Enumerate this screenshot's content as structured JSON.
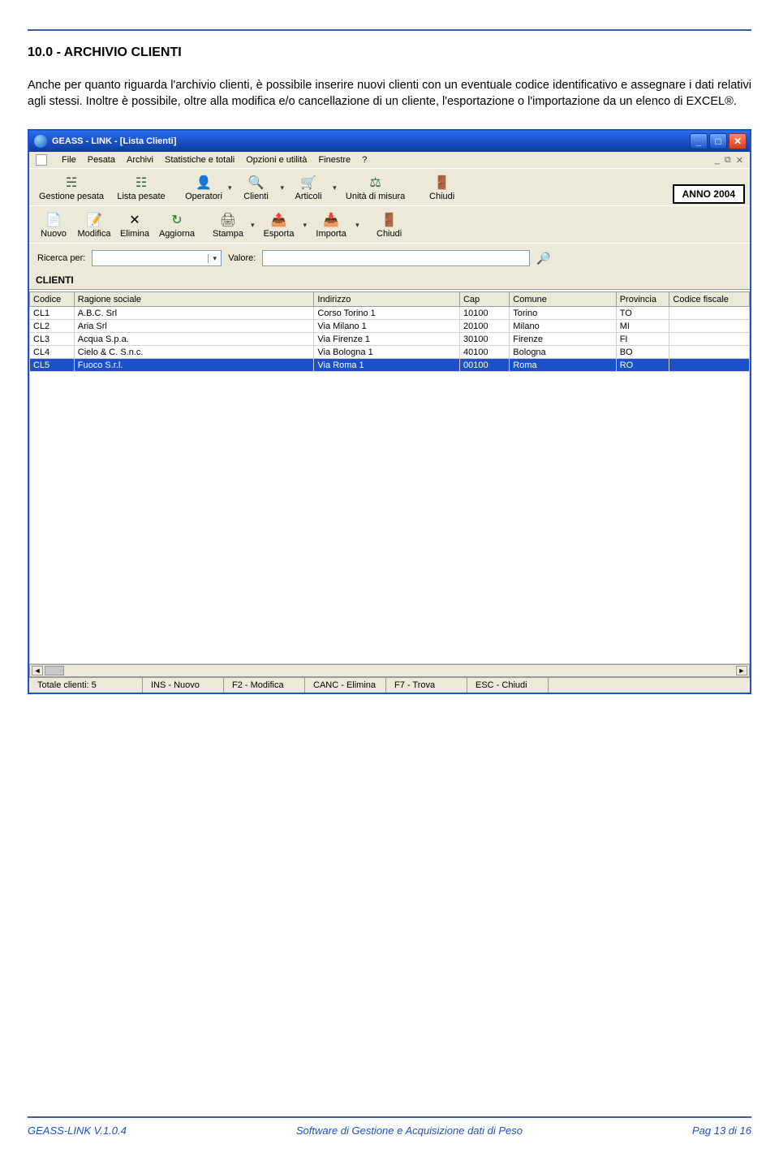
{
  "doc": {
    "section_number": "10.0 -  ARCHIVIO CLIENTI",
    "paragraph": "Anche per quanto riguarda l'archivio clienti, è possibile inserire nuovi clienti con un eventuale codice identificativo e assegnare i dati relativi agli stessi.\nInoltre è possibile, oltre alla modifica e/o cancellazione di un cliente, l'esportazione  o l'importazione da un elenco di EXCEL®."
  },
  "window": {
    "title": "GEASS - LINK - [Lista Clienti]",
    "menus": [
      "File",
      "Pesata",
      "Archivi",
      "Statistiche e totali",
      "Opzioni e utilità",
      "Finestre",
      "?"
    ],
    "toolbar_main": [
      {
        "label": "Gestione pesata",
        "icon": "☵"
      },
      {
        "label": "Lista pesate",
        "icon": "☷"
      },
      {
        "label": "Operatori",
        "icon": "👤"
      },
      {
        "label": "Clienti",
        "icon": "🔍"
      },
      {
        "label": "Articoli",
        "icon": "🛒"
      },
      {
        "label": "Unità di misura",
        "icon": "⚖"
      },
      {
        "label": "Chiudi",
        "icon": "🚪"
      }
    ],
    "anno_label": "ANNO 2004",
    "toolbar_sub": [
      {
        "label": "Nuovo",
        "icon": "📄"
      },
      {
        "label": "Modifica",
        "icon": "📝"
      },
      {
        "label": "Elimina",
        "icon": "✕"
      },
      {
        "label": "Aggiorna",
        "icon": "↻"
      },
      {
        "label": "Stampa",
        "icon": "🖨"
      },
      {
        "label": "Esporta",
        "icon": "📤"
      },
      {
        "label": "Importa",
        "icon": "📥"
      },
      {
        "label": "Chiudi",
        "icon": "🚪"
      }
    ],
    "search": {
      "ricerca_label": "Ricerca per:",
      "valore_label": "Valore:"
    },
    "grid_title": "CLIENTI",
    "columns": [
      "Codice",
      "Ragione sociale",
      "Indirizzo",
      "Cap",
      "Comune",
      "Provincia",
      "Codice fiscale"
    ],
    "rows": [
      {
        "cod": "CL1",
        "rs": "A.B.C. Srl",
        "ind": "Corso Torino 1",
        "cap": "10100",
        "com": "Torino",
        "prov": "TO",
        "cf": ""
      },
      {
        "cod": "CL2",
        "rs": "Aria Srl",
        "ind": "Via Milano 1",
        "cap": "20100",
        "com": "Milano",
        "prov": "MI",
        "cf": ""
      },
      {
        "cod": "CL3",
        "rs": "Acqua S.p.a.",
        "ind": "Via Firenze 1",
        "cap": "30100",
        "com": "Firenze",
        "prov": "FI",
        "cf": ""
      },
      {
        "cod": "CL4",
        "rs": "Cielo & C. S.n.c.",
        "ind": "Via Bologna 1",
        "cap": "40100",
        "com": "Bologna",
        "prov": "BO",
        "cf": ""
      },
      {
        "cod": "CL5",
        "rs": "Fuoco S.r.l.",
        "ind": "Via Roma 1",
        "cap": "00100",
        "com": "Roma",
        "prov": "RO",
        "cf": "",
        "selected": true
      }
    ],
    "status": [
      "Totale clienti: 5",
      "INS - Nuovo",
      "F2 - Modifica",
      "CANC - Elimina",
      "F7 - Trova",
      "ESC - Chiudi"
    ]
  },
  "footer": {
    "left": "GEASS-LINK V.1.0.4",
    "center": "Software di Gestione e Acquisizione dati di Peso",
    "right": "Pag 13 di 16"
  }
}
